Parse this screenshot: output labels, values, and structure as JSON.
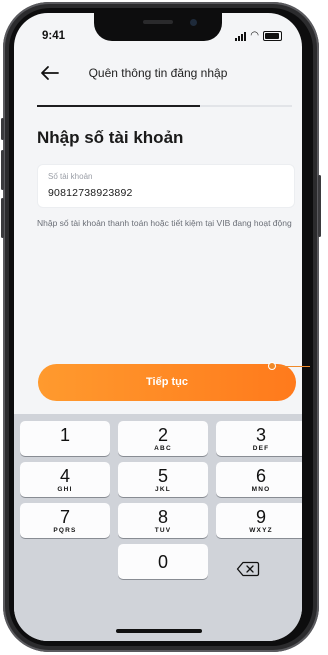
{
  "status_bar": {
    "time": "9:41"
  },
  "header": {
    "title": "Quên thông tin đăng nhập",
    "back_icon": "arrow-left-icon"
  },
  "progress": {
    "fraction": 0.64
  },
  "page": {
    "title": "Nhập số tài khoản"
  },
  "account_input": {
    "label": "Số tài khoản",
    "value": "90812738923892"
  },
  "helper_text": "Nhập số tài khoản thanh toán hoặc tiết kiệm tại VIB đang hoạt động",
  "cta": {
    "label": "Tiếp tục"
  },
  "keypad": {
    "keys": [
      {
        "num": "1",
        "letters": ""
      },
      {
        "num": "2",
        "letters": "ABC"
      },
      {
        "num": "3",
        "letters": "DEF"
      },
      {
        "num": "4",
        "letters": "GHI"
      },
      {
        "num": "5",
        "letters": "JKL"
      },
      {
        "num": "6",
        "letters": "MNO"
      },
      {
        "num": "7",
        "letters": "PQRS"
      },
      {
        "num": "8",
        "letters": "TUV"
      },
      {
        "num": "9",
        "letters": "WXYZ"
      },
      {
        "num": "0",
        "letters": ""
      }
    ],
    "delete_icon": "backspace-icon"
  },
  "colors": {
    "accent": "#ff8a24",
    "annotation": "#f08a2a"
  }
}
